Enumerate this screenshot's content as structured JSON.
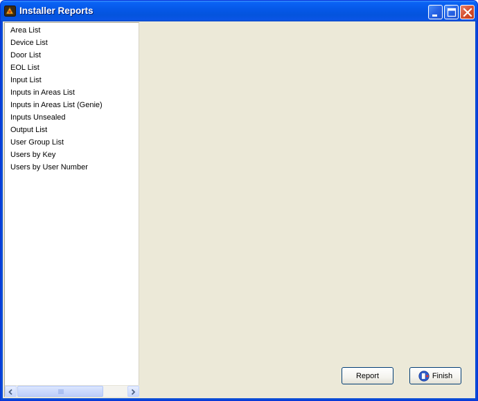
{
  "window": {
    "title": "Installer Reports",
    "title_icon": "installer-app-icon"
  },
  "titlebar_buttons": {
    "minimize_icon": "minimize-icon",
    "maximize_icon": "maximize-icon",
    "close_icon": "close-icon"
  },
  "report_list": {
    "items": [
      {
        "label": "Area List"
      },
      {
        "label": "Device List"
      },
      {
        "label": "Door List"
      },
      {
        "label": "EOL List"
      },
      {
        "label": "Input List"
      },
      {
        "label": "Inputs in Areas List"
      },
      {
        "label": "Inputs in Areas List (Genie)"
      },
      {
        "label": "Inputs Unsealed"
      },
      {
        "label": "Output List"
      },
      {
        "label": "User Group List"
      },
      {
        "label": "Users by Key"
      },
      {
        "label": "Users by User Number"
      }
    ]
  },
  "scrollbar": {
    "left_icon": "scroll-left-arrow-icon",
    "right_icon": "scroll-right-arrow-icon"
  },
  "buttons": {
    "report_label": "Report",
    "finish_label": "Finish",
    "finish_icon": "exit-door-icon"
  },
  "colors": {
    "titlebar": "#0558e8",
    "client_background": "#ece9d8",
    "list_background": "#ffffff",
    "close_button": "#d6502f"
  }
}
